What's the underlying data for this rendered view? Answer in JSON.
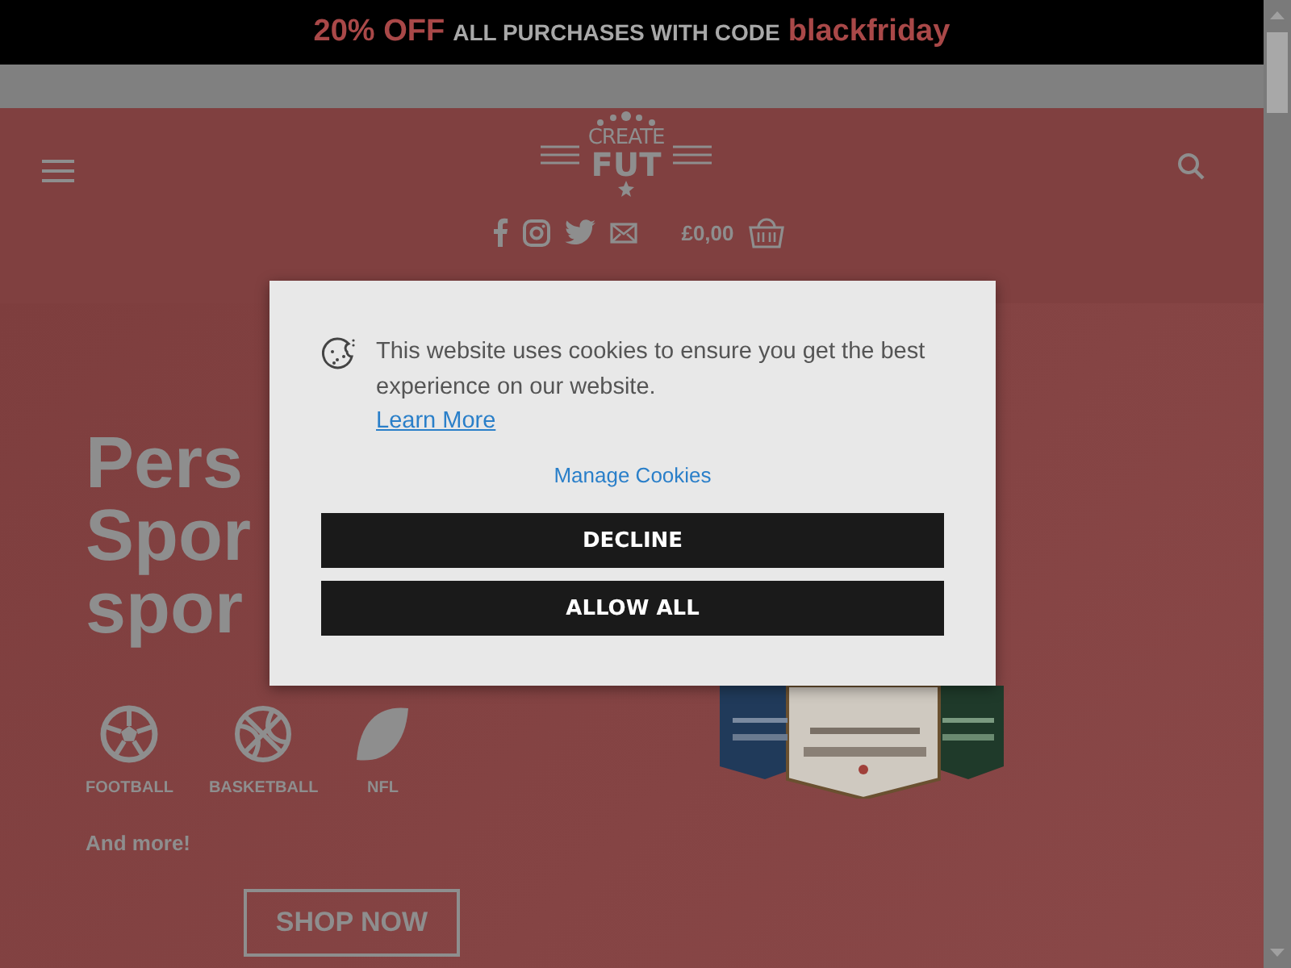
{
  "promo_bar": {
    "discount": "20% OFF",
    "text": "ALL PURCHASES WITH CODE",
    "code": "blackfriday"
  },
  "header": {
    "logo": {
      "line1": "CREATE",
      "line2": "FUT"
    },
    "social": [
      {
        "kind": "facebook"
      },
      {
        "kind": "instagram"
      },
      {
        "kind": "twitter"
      },
      {
        "kind": "mail"
      }
    ],
    "cart_total": "£0,00"
  },
  "hero": {
    "heading": [
      "Pers",
      "Spor",
      "spor"
    ],
    "sports": [
      {
        "label": "FOOTBALL",
        "kind": "football"
      },
      {
        "label": "BASKETBALL",
        "kind": "basketball"
      },
      {
        "label": "NFL",
        "kind": "nfl"
      }
    ],
    "more": "And more!",
    "cta": "SHOP NOW",
    "image": {
      "kind": "picture"
    }
  },
  "cookie_dialog": {
    "message": "This website uses cookies to ensure you get the best experience on our website.",
    "learn_more": "Learn More",
    "manage": "Manage Cookies",
    "buttons": [
      "DECLINE",
      "ALLOW ALL"
    ]
  }
}
